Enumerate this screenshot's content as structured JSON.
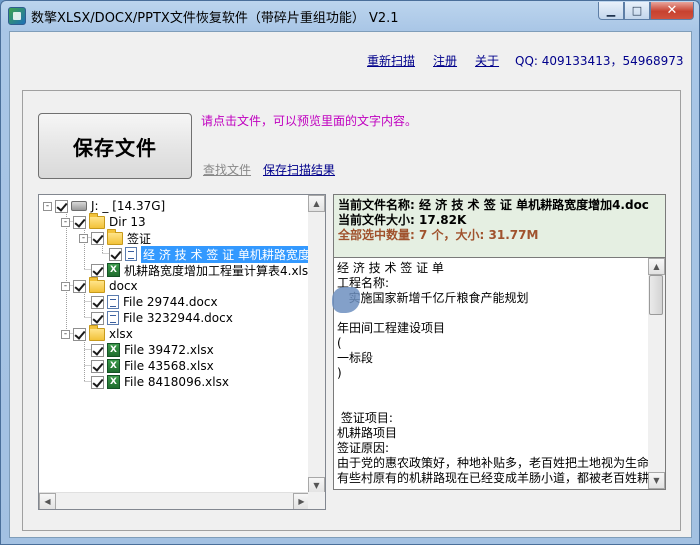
{
  "window": {
    "title": "数擎XLSX/DOCX/PPTX文件恢复软件（带碎片重组功能） V2.1",
    "minimize": "▁",
    "maximize": "□",
    "close": "✕"
  },
  "toplinks": {
    "rescan": "重新扫描",
    "register": "注册",
    "about": "关于",
    "qq": "QQ: 409133413，54968973"
  },
  "actions": {
    "save_button": "保存文件",
    "hint": "请点击文件，可以预览里面的文字内容。",
    "find_file": "查找文件",
    "save_scan": "保存扫描结果"
  },
  "tree": [
    {
      "label": "J: _ [14.37G]",
      "icon": "drive-icon",
      "level": 0,
      "expander": "-"
    },
    {
      "label": "Dir 13",
      "icon": "folder-icon",
      "level": 1,
      "expander": "-"
    },
    {
      "label": "签证",
      "icon": "folder-icon",
      "level": 2,
      "expander": "-"
    },
    {
      "label": "经 济 技 术 签 证 单机耕路宽度增",
      "icon": "docx-icon",
      "level": 3,
      "selected": true
    },
    {
      "label": "机耕路宽度增加工程量计算表4.xlsx",
      "icon": "xlsx-icon",
      "level": 2
    },
    {
      "label": "docx",
      "icon": "folder-icon",
      "level": 1,
      "expander": "-"
    },
    {
      "label": "File 29744.docx",
      "icon": "docx-icon",
      "level": 2
    },
    {
      "label": "File 3232944.docx",
      "icon": "docx-icon",
      "level": 2
    },
    {
      "label": "xlsx",
      "icon": "folder-icon",
      "level": 1,
      "expander": "-"
    },
    {
      "label": "File 39472.xlsx",
      "icon": "xlsx-icon",
      "level": 2
    },
    {
      "label": "File 43568.xlsx",
      "icon": "xlsx-icon",
      "level": 2
    },
    {
      "label": "File 8418096.xlsx",
      "icon": "xlsx-icon",
      "level": 2
    }
  ],
  "info": {
    "name_label": "当前文件名称:",
    "name_value": "经 济 技 术 签 证 单机耕路宽度增加4.doc",
    "size_label": "当前文件大小:",
    "size_value": "17.82K",
    "sum_label": "全部选中数量:",
    "sum_value": "7 个，大小:",
    "sum_size": "31.77M"
  },
  "preview": {
    "lines": [
      "经 济 技 术 签 证 单",
      "工程名称:",
      "   实施国家新增千亿斤粮食产能规划",
      "",
      "年田间工程建设项目",
      "(",
      "一标段",
      ")",
      "",
      "",
      " 签证项目:",
      "机耕路项目",
      "签证原因:",
      "由于党的惠农政策好，种地补贴多，老百姓把土地视为生命",
      "有些村原有的机耕路现在已经变成羊肠小道，都被老百姓耕"
    ]
  },
  "colors": {
    "link": "#00008b",
    "hint": "#c000c0",
    "selection": "#3399ff",
    "info_bg": "#e5efe2",
    "summary": "#a0522d"
  }
}
